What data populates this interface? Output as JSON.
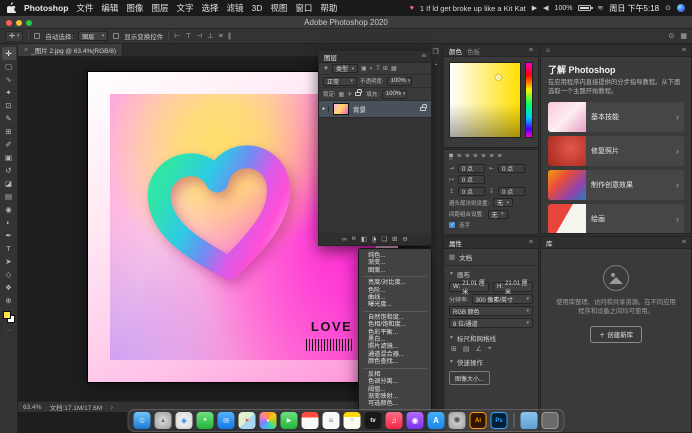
{
  "menubar": {
    "app_name": "Photoshop",
    "menus": [
      "文件",
      "编辑",
      "图像",
      "图层",
      "文字",
      "选择",
      "滤镜",
      "3D",
      "视图",
      "窗口",
      "帮助"
    ],
    "song_title": "1 If ld get broke up like a Kit Kat",
    "battery_level": "100%",
    "clock": "周日 下午5:18"
  },
  "window": {
    "title": "Adobe Photoshop 2020",
    "document_tab": "_图片 2.jpg @ 63.4%(RGB/8)"
  },
  "options_bar": {
    "auto_select_label": "自动选择:",
    "auto_select_value": "图层",
    "show_transform_label": "显示变换控件"
  },
  "tools": [
    {
      "name": "move-tool",
      "glyph": "✛"
    },
    {
      "name": "marquee-tool",
      "glyph": "▢"
    },
    {
      "name": "lasso-tool",
      "glyph": "∿"
    },
    {
      "name": "magic-wand-tool",
      "glyph": "✦"
    },
    {
      "name": "crop-tool",
      "glyph": "⊡"
    },
    {
      "name": "eyedropper-tool",
      "glyph": "✎"
    },
    {
      "name": "healing-brush-tool",
      "glyph": "⊞"
    },
    {
      "name": "brush-tool",
      "glyph": "✐"
    },
    {
      "name": "clone-stamp-tool",
      "glyph": "▣"
    },
    {
      "name": "history-brush-tool",
      "glyph": "↺"
    },
    {
      "name": "eraser-tool",
      "glyph": "◪"
    },
    {
      "name": "gradient-tool",
      "glyph": "▤"
    },
    {
      "name": "blur-tool",
      "glyph": "◉"
    },
    {
      "name": "dodge-tool",
      "glyph": "◐"
    },
    {
      "name": "pen-tool",
      "glyph": "✒"
    },
    {
      "name": "type-tool",
      "glyph": "T"
    },
    {
      "name": "path-selection-tool",
      "glyph": "➤"
    },
    {
      "name": "shape-tool",
      "glyph": "◇"
    },
    {
      "name": "hand-tool",
      "glyph": "❖"
    },
    {
      "name": "zoom-tool",
      "glyph": "⊕"
    }
  ],
  "artwork": {
    "caption": "LOVE"
  },
  "layers_panel": {
    "tab_label": "图层",
    "filter_label": "类型",
    "blend_mode": "正常",
    "opacity_label": "不透明度:",
    "opacity_value": "100%",
    "lock_label": "锁定:",
    "fill_label": "填充:",
    "fill_value": "100%",
    "layer_name": "背景"
  },
  "adjustment_menu": {
    "items": [
      "纯色...",
      "渐变...",
      "图案...",
      "亮度/对比度...",
      "色阶...",
      "曲线...",
      "曝光度...",
      "自然饱和度...",
      "色相/饱和度...",
      "色彩平衡...",
      "黑白...",
      "照片滤镜...",
      "通道混合器...",
      "颜色查找...",
      "反相",
      "色调分离...",
      "阈值...",
      "渐变映射...",
      "可选颜色..."
    ]
  },
  "color_panel": {
    "tab_color": "颜色",
    "tab_swatches": "色板"
  },
  "paragraph_panel": {
    "indent_left": "0 点",
    "indent_right": "0 点",
    "indent_first": "0 点",
    "space_before": "0 点",
    "space_after": "0 点",
    "kinsoku_label": "避头尾法则设置:",
    "kinsoku_value": "无",
    "mojikumi_label": "间距组合设置:",
    "mojikumi_value": "无",
    "hyphenate_label": "连字"
  },
  "properties_panel": {
    "tab_label": "属性",
    "doc_type": "文档",
    "section_canvas": "画布",
    "w_label": "W:",
    "w_value": "21.01 厘米",
    "h_label": "H:",
    "h_value": "21.01 厘米",
    "resolution_label": "分辨率:",
    "resolution_value": "300 像素/英寸",
    "mode_value": "RGB 颜色",
    "depth_value": "8 位/通道",
    "section_rulers": "标尺和网格线",
    "section_quick": "快速操作",
    "quick_action_image_size": "图像大小..."
  },
  "learn_panel": {
    "title": "了解 Photoshop",
    "description": "在应用程序内直接提供的分步指导教程。从下面选取一个主题开始教程。",
    "cards": [
      {
        "label": "基本技能"
      },
      {
        "label": "修复照片"
      },
      {
        "label": "制作创意效果"
      },
      {
        "label": "绘画"
      }
    ]
  },
  "libraries_panel": {
    "tab_label": "库",
    "empty_text": "使用库整理、访问和共享资源。在不同应用程序和设备之间均可使用。",
    "create_button": "＋ 创建新库"
  },
  "status_bar": {
    "zoom": "63.4%",
    "doc_info": "文档:17.1M/17.6M"
  },
  "dock_icons": [
    "finder",
    "launchpad",
    "safari",
    "messages",
    "mail",
    "maps",
    "photos",
    "facetime",
    "calendar",
    "reminders",
    "notes",
    "tv",
    "music",
    "podcasts",
    "app-store",
    "system-preferences",
    "illustrator",
    "photoshop",
    "folder",
    "trash"
  ],
  "colors": {
    "accent_blue": "#31a8ff",
    "heart_gradient": [
      "#2fe6a8",
      "#2fc9e6",
      "#ff4fd6"
    ],
    "canvas_yellow": "#ffdf6b",
    "canvas_magenta": "#ff2bd6"
  }
}
